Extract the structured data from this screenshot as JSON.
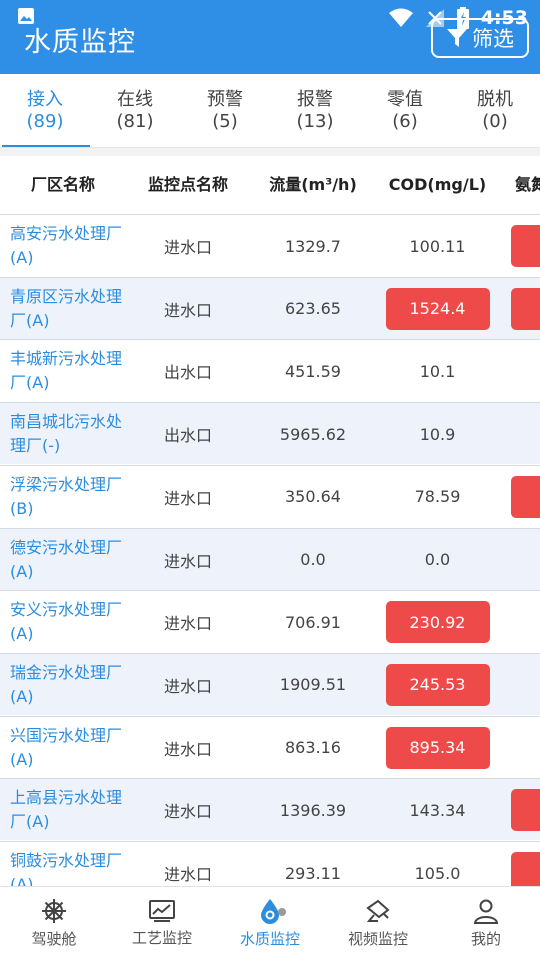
{
  "status_bar": {
    "time": "4:53"
  },
  "app": {
    "title": "水质监控",
    "filter_label": "筛选"
  },
  "tabs": [
    {
      "label": "接入",
      "count": "(89)",
      "active": true
    },
    {
      "label": "在线",
      "count": "(81)",
      "active": false
    },
    {
      "label": "预警",
      "count": "(5)",
      "active": false
    },
    {
      "label": "报警",
      "count": "(13)",
      "active": false
    },
    {
      "label": "零值",
      "count": "(6)",
      "active": false
    },
    {
      "label": "脱机",
      "count": "(0)",
      "active": false
    }
  ],
  "table": {
    "headers": [
      "厂区名称",
      "监控点名称",
      "流量(m³/h)",
      "COD(mg/L)",
      "氨氮"
    ],
    "rows": [
      {
        "plant": "高安污水处理厂(A)",
        "point": "进水口",
        "flow": "1329.7",
        "cod": "100.11",
        "cod_alarm": false,
        "ammonia_alarm": true
      },
      {
        "plant": "青原区污水处理厂(A)",
        "point": "进水口",
        "flow": "623.65",
        "cod": "1524.4",
        "cod_alarm": true,
        "ammonia_alarm": true
      },
      {
        "plant": "丰城新污水处理厂(A)",
        "point": "出水口",
        "flow": "451.59",
        "cod": "10.1",
        "cod_alarm": false,
        "ammonia_alarm": false
      },
      {
        "plant": "南昌城北污水处理厂(-)",
        "point": "出水口",
        "flow": "5965.62",
        "cod": "10.9",
        "cod_alarm": false,
        "ammonia_alarm": false
      },
      {
        "plant": "浮梁污水处理厂(B)",
        "point": "进水口",
        "flow": "350.64",
        "cod": "78.59",
        "cod_alarm": false,
        "ammonia_alarm": true
      },
      {
        "plant": "德安污水处理厂(A)",
        "point": "进水口",
        "flow": "0.0",
        "cod": "0.0",
        "cod_alarm": false,
        "ammonia_alarm": false
      },
      {
        "plant": "安义污水处理厂(A)",
        "point": "进水口",
        "flow": "706.91",
        "cod": "230.92",
        "cod_alarm": true,
        "ammonia_alarm": false
      },
      {
        "plant": "瑞金污水处理厂(A)",
        "point": "进水口",
        "flow": "1909.51",
        "cod": "245.53",
        "cod_alarm": true,
        "ammonia_alarm": false
      },
      {
        "plant": "兴国污水处理厂(A)",
        "point": "进水口",
        "flow": "863.16",
        "cod": "895.34",
        "cod_alarm": true,
        "ammonia_alarm": false
      },
      {
        "plant": "上高县污水处理厂(A)",
        "point": "进水口",
        "flow": "1396.39",
        "cod": "143.34",
        "cod_alarm": false,
        "ammonia_alarm": true
      },
      {
        "plant": "铜鼓污水处理厂(A)",
        "point": "进水口",
        "flow": "293.11",
        "cod": "105.0",
        "cod_alarm": false,
        "ammonia_alarm": true
      }
    ]
  },
  "bottom_nav": [
    {
      "label": "驾驶舱",
      "icon": "ship-wheel-icon",
      "active": false
    },
    {
      "label": "工艺监控",
      "icon": "line-chart-icon",
      "active": false
    },
    {
      "label": "水质监控",
      "icon": "water-drop-icon",
      "active": true
    },
    {
      "label": "视频监控",
      "icon": "camera-icon",
      "active": false
    },
    {
      "label": "我的",
      "icon": "user-icon",
      "active": false
    }
  ],
  "colors": {
    "primary": "#2f8fe6",
    "alarm": "#ef4a4a",
    "row_alt": "#eef2fb",
    "link": "#2b8de0"
  }
}
